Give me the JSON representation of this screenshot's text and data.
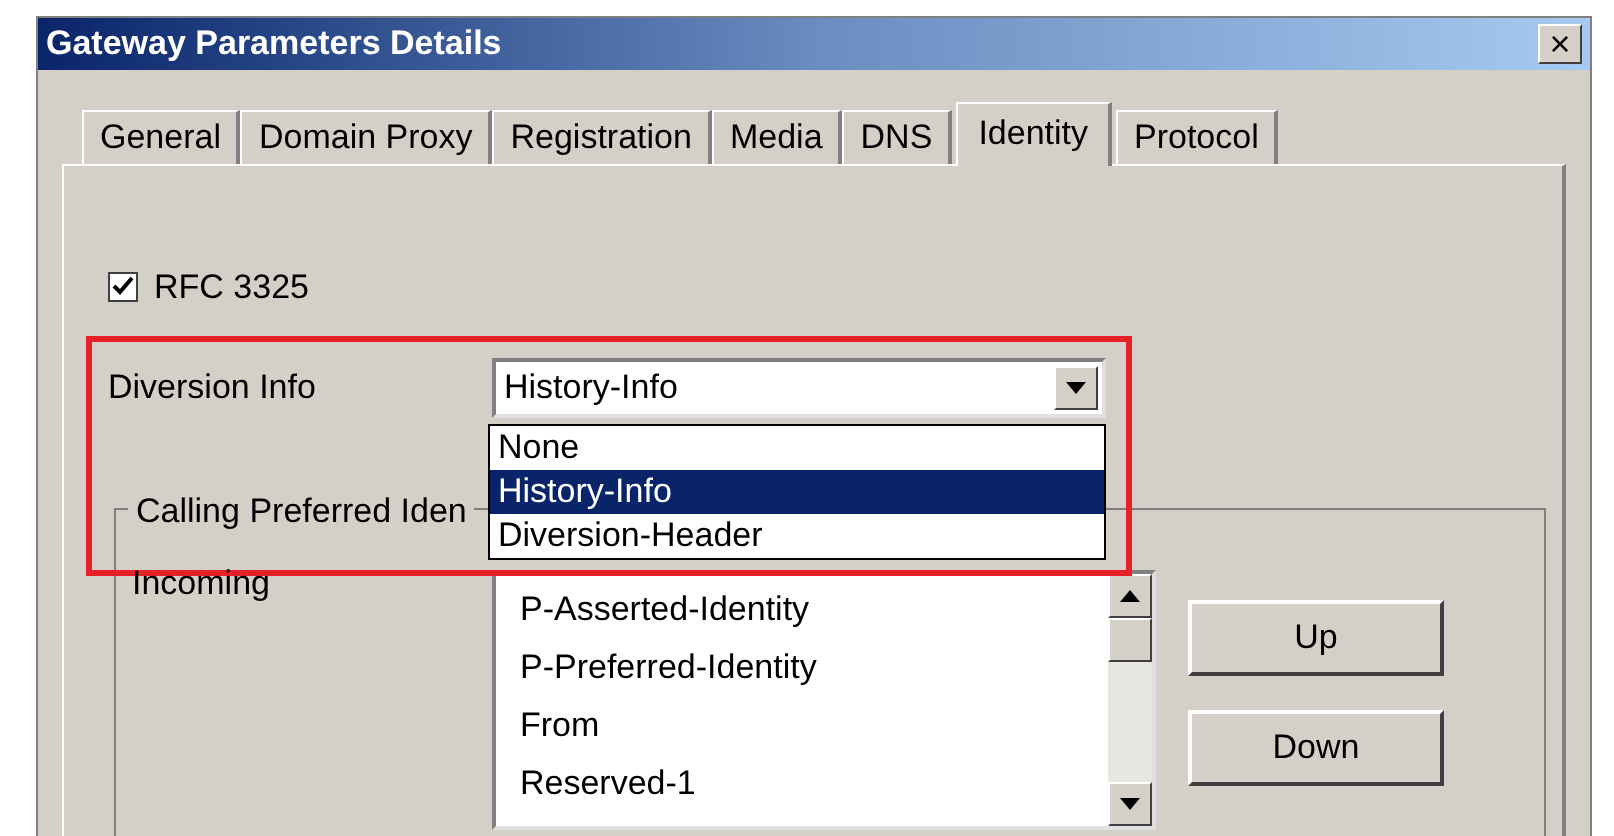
{
  "window": {
    "title": "Gateway Parameters Details",
    "close": "×"
  },
  "tabs": [
    {
      "label": "General",
      "selected": false
    },
    {
      "label": "Domain Proxy",
      "selected": false
    },
    {
      "label": "Registration",
      "selected": false
    },
    {
      "label": "Media",
      "selected": false
    },
    {
      "label": "DNS",
      "selected": false
    },
    {
      "label": "Identity",
      "selected": true
    },
    {
      "label": "Protocol",
      "selected": false
    }
  ],
  "rfc_checkbox": {
    "label": "RFC 3325",
    "checked": true
  },
  "diversion_info": {
    "label": "Diversion Info",
    "value": "History-Info",
    "open": true,
    "options": [
      {
        "label": "None",
        "selected": false
      },
      {
        "label": "History-Info",
        "selected": true
      },
      {
        "label": "Diversion-Header",
        "selected": false
      }
    ]
  },
  "highlight": {
    "color": "#e8202a"
  },
  "group": {
    "title": "Calling Preferred Iden",
    "incoming_label": "Incoming",
    "list": [
      {
        "label": "P-Asserted-Identity",
        "selected": false
      },
      {
        "label": "P-Preferred-Identity",
        "selected": false
      },
      {
        "label": "From",
        "selected": false
      },
      {
        "label": "Reserved-1",
        "selected": false
      }
    ],
    "buttons": [
      "Up",
      "Down"
    ]
  }
}
